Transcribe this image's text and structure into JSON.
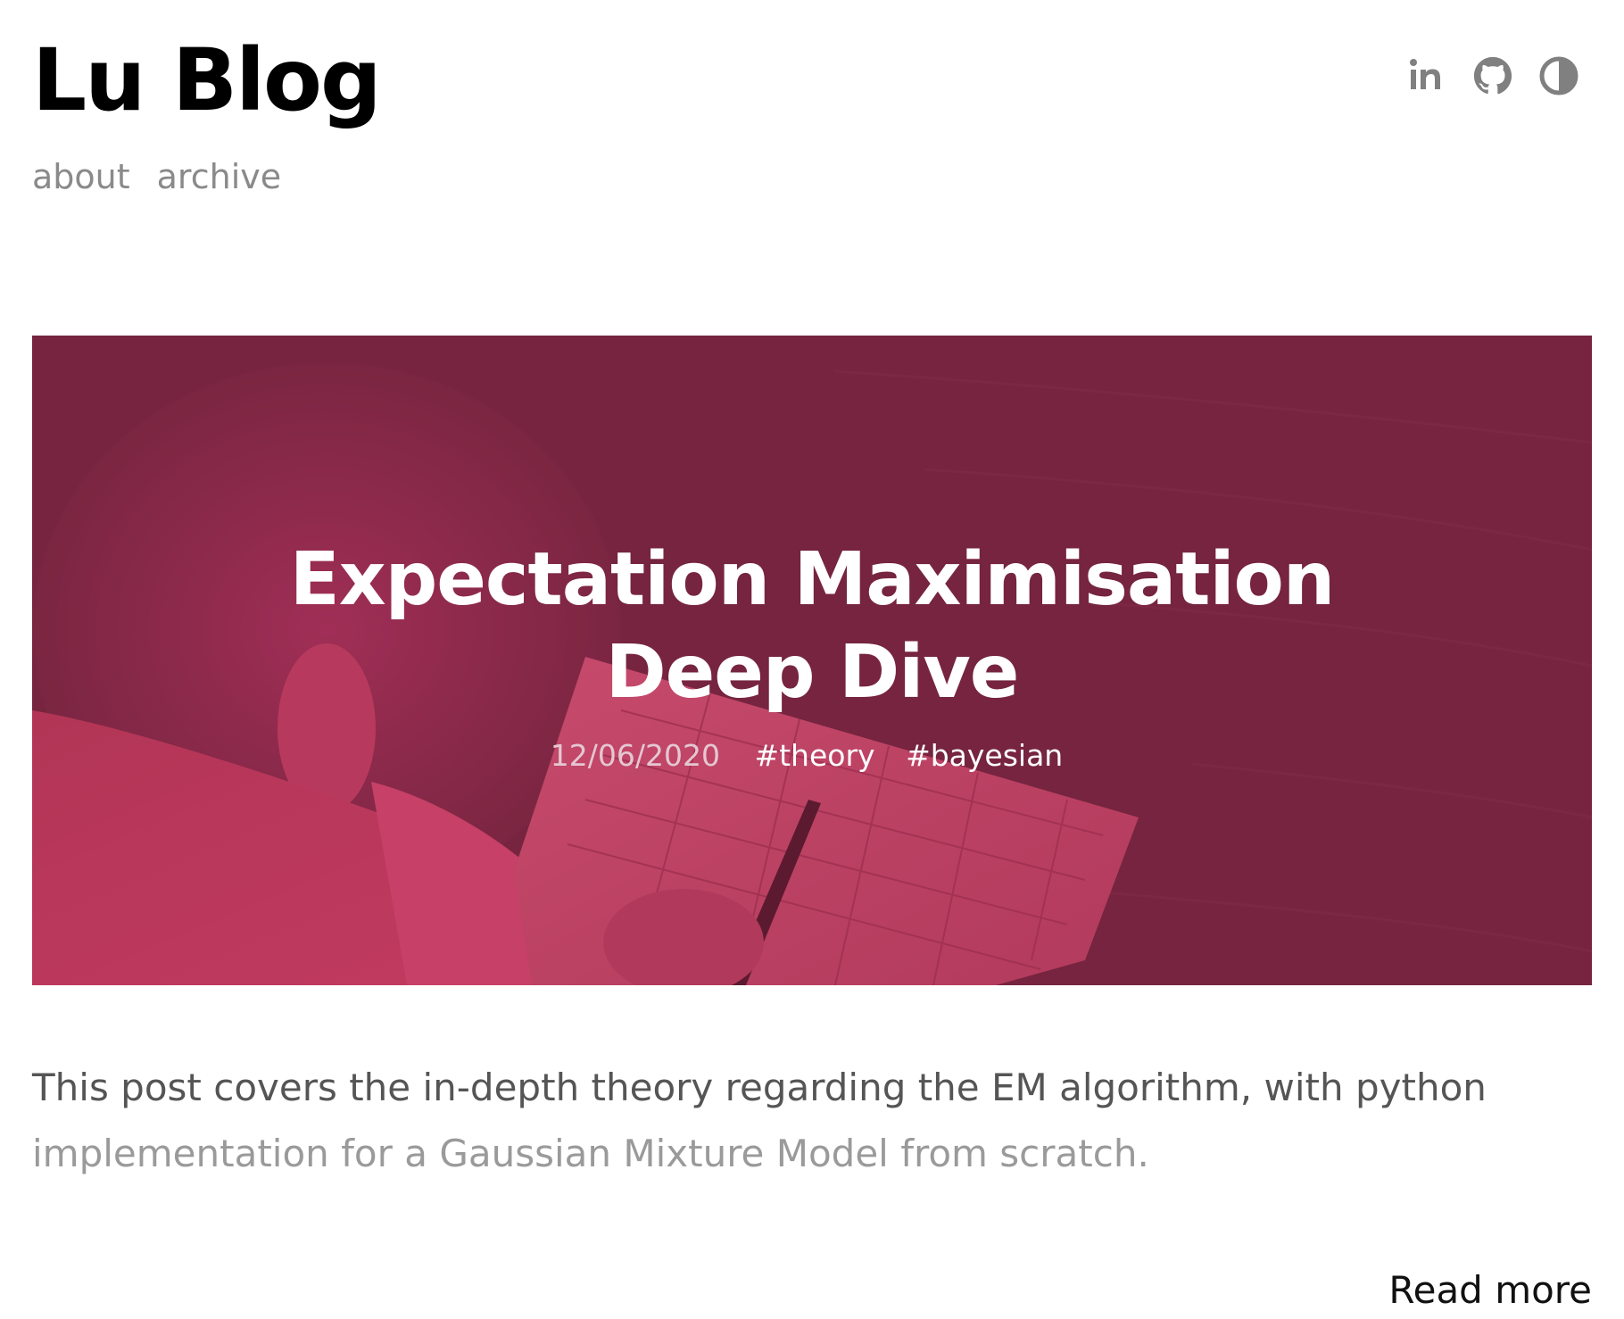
{
  "site": {
    "title": "Lu Blog"
  },
  "nav": {
    "items": [
      {
        "label": "about"
      },
      {
        "label": "archive"
      }
    ]
  },
  "header_icons": [
    {
      "name": "linkedin-icon"
    },
    {
      "name": "github-icon"
    },
    {
      "name": "theme-toggle-icon"
    }
  ],
  "post": {
    "title_line1": "Expectation Maximisation",
    "title_line2": "Deep Dive",
    "date": "12/06/2020",
    "tags": [
      "#theory",
      "#bayesian"
    ],
    "excerpt_line1": "This post covers the in-depth theory regarding the EM algorithm, with python",
    "excerpt_line2": "implementation for a Gaussian Mixture Model from scratch.",
    "read_more": "Read more"
  },
  "colors": {
    "hero_overlay": "#76243f",
    "hero_highlight": "#c0395f",
    "nav_text": "#8a8a8a",
    "icon": "#808080"
  }
}
